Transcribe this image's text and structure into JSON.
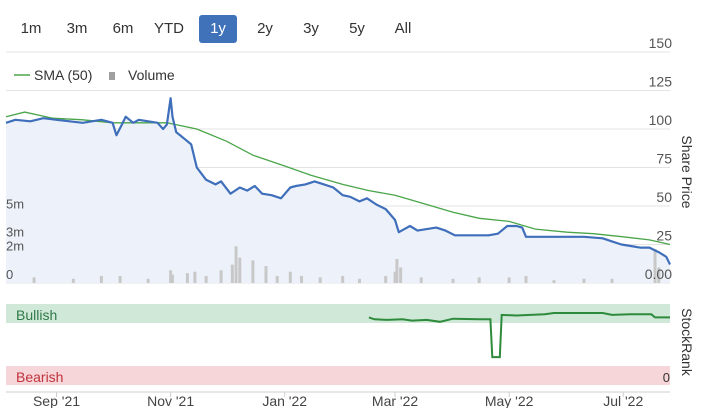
{
  "range_selector": {
    "buttons": [
      "1m",
      "3m",
      "6m",
      "YTD",
      "1y",
      "2y",
      "3y",
      "5y",
      "All"
    ],
    "active": "1y"
  },
  "legend": {
    "sma_label": "SMA (50)",
    "volume_label": "Volume"
  },
  "colors": {
    "price_line": "#3f6fba",
    "price_fill": "#edf2fa",
    "sma_line": "#4aa54a",
    "volume_bar": "#c8c8c8",
    "stockrank_line": "#2e8b3c",
    "bullish_band": "#cfe8d8",
    "bearish_band": "#f6d6d8",
    "grid": "#e3e3e3",
    "active_button": "#3f72b8"
  },
  "chart_data": [
    {
      "type": "line",
      "title": "",
      "xlabel": "",
      "ylabel": "Share Price",
      "ylim": [
        0,
        150
      ],
      "y_ticks": [
        "0.00",
        "25",
        "50",
        "75",
        "100",
        "125",
        "150"
      ],
      "volume_axis": {
        "ticks": [
          "0",
          "2m",
          "3m",
          "5m"
        ],
        "values": [
          0,
          2,
          3,
          5
        ],
        "max_m": 7.5
      },
      "x_range": [
        "2021-08-05",
        "2022-07-26"
      ],
      "x_ticks": [
        {
          "label": "Sep '21",
          "date": "2021-09-01"
        },
        {
          "label": "Nov '21",
          "date": "2021-11-01"
        },
        {
          "label": "Jan '22",
          "date": "2022-01-01"
        },
        {
          "label": "Mar '22",
          "date": "2022-03-01"
        },
        {
          "label": "May '22",
          "date": "2022-05-01"
        },
        {
          "label": "Jul '22",
          "date": "2022-07-01"
        }
      ],
      "series": [
        {
          "name": "Share Price",
          "points": [
            [
              "2021-08-05",
              104
            ],
            [
              "2021-08-10",
              106
            ],
            [
              "2021-08-18",
              105
            ],
            [
              "2021-08-25",
              107
            ],
            [
              "2021-09-01",
              106
            ],
            [
              "2021-09-08",
              105
            ],
            [
              "2021-09-15",
              104
            ],
            [
              "2021-09-20",
              105
            ],
            [
              "2021-09-25",
              106
            ],
            [
              "2021-10-01",
              104
            ],
            [
              "2021-10-03",
              96
            ],
            [
              "2021-10-06",
              103
            ],
            [
              "2021-10-08",
              108
            ],
            [
              "2021-10-12",
              104
            ],
            [
              "2021-10-15",
              106
            ],
            [
              "2021-10-20",
              105
            ],
            [
              "2021-10-25",
              104
            ],
            [
              "2021-10-28",
              100
            ],
            [
              "2021-10-30",
              103
            ],
            [
              "2021-11-01",
              120
            ],
            [
              "2021-11-02",
              108
            ],
            [
              "2021-11-04",
              98
            ],
            [
              "2021-11-08",
              94
            ],
            [
              "2021-11-12",
              90
            ],
            [
              "2021-11-15",
              75
            ],
            [
              "2021-11-20",
              67
            ],
            [
              "2021-11-25",
              64
            ],
            [
              "2021-11-28",
              66
            ],
            [
              "2021-12-03",
              58
            ],
            [
              "2021-12-08",
              62
            ],
            [
              "2021-12-12",
              60
            ],
            [
              "2021-12-16",
              63
            ],
            [
              "2021-12-20",
              58
            ],
            [
              "2021-12-25",
              57
            ],
            [
              "2021-12-30",
              55
            ],
            [
              "2022-01-04",
              62
            ],
            [
              "2022-01-07",
              63
            ],
            [
              "2022-01-12",
              64
            ],
            [
              "2022-01-17",
              66
            ],
            [
              "2022-01-22",
              64
            ],
            [
              "2022-01-27",
              62
            ],
            [
              "2022-02-01",
              57
            ],
            [
              "2022-02-05",
              56
            ],
            [
              "2022-02-10",
              53
            ],
            [
              "2022-02-14",
              55
            ],
            [
              "2022-02-19",
              51
            ],
            [
              "2022-02-24",
              48
            ],
            [
              "2022-03-01",
              41
            ],
            [
              "2022-03-03",
              33
            ],
            [
              "2022-03-06",
              35
            ],
            [
              "2022-03-09",
              37
            ],
            [
              "2022-03-13",
              34
            ],
            [
              "2022-03-18",
              35
            ],
            [
              "2022-03-23",
              36
            ],
            [
              "2022-03-28",
              34
            ],
            [
              "2022-04-02",
              31
            ],
            [
              "2022-04-10",
              31
            ],
            [
              "2022-04-20",
              31
            ],
            [
              "2022-04-25",
              32
            ],
            [
              "2022-04-30",
              37
            ],
            [
              "2022-05-05",
              37
            ],
            [
              "2022-05-08",
              36
            ],
            [
              "2022-05-10",
              30
            ],
            [
              "2022-05-20",
              30
            ],
            [
              "2022-05-30",
              30
            ],
            [
              "2022-06-10",
              30
            ],
            [
              "2022-06-20",
              29
            ],
            [
              "2022-06-25",
              27
            ],
            [
              "2022-06-30",
              25
            ],
            [
              "2022-07-05",
              24
            ],
            [
              "2022-07-10",
              23
            ],
            [
              "2022-07-15",
              23
            ],
            [
              "2022-07-20",
              20
            ],
            [
              "2022-07-24",
              17
            ],
            [
              "2022-07-26",
              12
            ]
          ]
        },
        {
          "name": "SMA (50)",
          "points": [
            [
              "2021-08-05",
              108
            ],
            [
              "2021-08-15",
              111
            ],
            [
              "2021-08-30",
              107
            ],
            [
              "2021-09-15",
              106
            ],
            [
              "2021-10-01",
              104
            ],
            [
              "2021-10-15",
              104
            ],
            [
              "2021-10-30",
              104
            ],
            [
              "2021-11-15",
              100
            ],
            [
              "2021-12-01",
              92
            ],
            [
              "2021-12-15",
              83
            ],
            [
              "2022-01-01",
              76
            ],
            [
              "2022-01-15",
              70
            ],
            [
              "2022-02-01",
              64
            ],
            [
              "2022-02-15",
              60
            ],
            [
              "2022-03-01",
              57
            ],
            [
              "2022-03-15",
              52
            ],
            [
              "2022-04-01",
              46
            ],
            [
              "2022-04-15",
              42
            ],
            [
              "2022-05-01",
              40
            ],
            [
              "2022-05-15",
              35
            ],
            [
              "2022-06-01",
              33
            ],
            [
              "2022-06-15",
              32
            ],
            [
              "2022-07-01",
              30
            ],
            [
              "2022-07-15",
              28
            ],
            [
              "2022-07-26",
              25
            ]
          ]
        },
        {
          "name": "Volume",
          "unit": "m",
          "bars": [
            [
              "2021-08-20",
              0.4
            ],
            [
              "2021-09-10",
              0.3
            ],
            [
              "2021-09-25",
              0.5
            ],
            [
              "2021-10-05",
              0.5
            ],
            [
              "2021-10-20",
              0.3
            ],
            [
              "2021-11-01",
              0.9
            ],
            [
              "2021-11-02",
              0.6
            ],
            [
              "2021-11-10",
              0.7
            ],
            [
              "2021-11-14",
              0.8
            ],
            [
              "2021-11-20",
              0.5
            ],
            [
              "2021-11-28",
              0.9
            ],
            [
              "2021-12-04",
              1.3
            ],
            [
              "2021-12-06",
              2.6
            ],
            [
              "2021-12-08",
              1.8
            ],
            [
              "2021-12-15",
              1.6
            ],
            [
              "2021-12-22",
              1.2
            ],
            [
              "2021-12-28",
              0.5
            ],
            [
              "2022-01-04",
              0.8
            ],
            [
              "2022-01-10",
              0.5
            ],
            [
              "2022-01-20",
              0.4
            ],
            [
              "2022-02-01",
              0.5
            ],
            [
              "2022-02-10",
              0.3
            ],
            [
              "2022-02-24",
              0.5
            ],
            [
              "2022-03-01",
              0.8
            ],
            [
              "2022-03-02",
              1.7
            ],
            [
              "2022-03-04",
              1.1
            ],
            [
              "2022-03-15",
              0.4
            ],
            [
              "2022-04-01",
              0.3
            ],
            [
              "2022-04-15",
              0.4
            ],
            [
              "2022-05-01",
              0.4
            ],
            [
              "2022-05-10",
              0.5
            ],
            [
              "2022-05-25",
              0.2
            ],
            [
              "2022-06-10",
              0.3
            ],
            [
              "2022-06-25",
              0.3
            ],
            [
              "2022-07-18",
              2.4
            ],
            [
              "2022-07-20",
              1.1
            ]
          ]
        }
      ]
    },
    {
      "type": "line",
      "title": "",
      "ylabel": "StockRank",
      "band_labels": {
        "top": "Bullish",
        "bottom": "Bearish"
      },
      "y_tick": "0",
      "series": [
        {
          "name": "StockRank",
          "points": [
            [
              "2022-02-15",
              0.93
            ],
            [
              "2022-02-18",
              0.9
            ],
            [
              "2022-02-25",
              0.89
            ],
            [
              "2022-03-05",
              0.9
            ],
            [
              "2022-03-10",
              0.88
            ],
            [
              "2022-03-18",
              0.89
            ],
            [
              "2022-03-25",
              0.86
            ],
            [
              "2022-04-01",
              0.91
            ],
            [
              "2022-04-15",
              0.9
            ],
            [
              "2022-04-21",
              0.9
            ],
            [
              "2022-04-22",
              0.3
            ],
            [
              "2022-04-24",
              0.3
            ],
            [
              "2022-04-26",
              0.3
            ],
            [
              "2022-04-27",
              0.97
            ],
            [
              "2022-05-05",
              0.96
            ],
            [
              "2022-05-20",
              0.98
            ],
            [
              "2022-05-25",
              1.0
            ],
            [
              "2022-06-05",
              1.0
            ],
            [
              "2022-06-20",
              1.0
            ],
            [
              "2022-06-25",
              0.97
            ],
            [
              "2022-07-05",
              0.98
            ],
            [
              "2022-07-16",
              0.98
            ],
            [
              "2022-07-18",
              0.93
            ],
            [
              "2022-07-26",
              0.93
            ]
          ]
        }
      ]
    }
  ]
}
